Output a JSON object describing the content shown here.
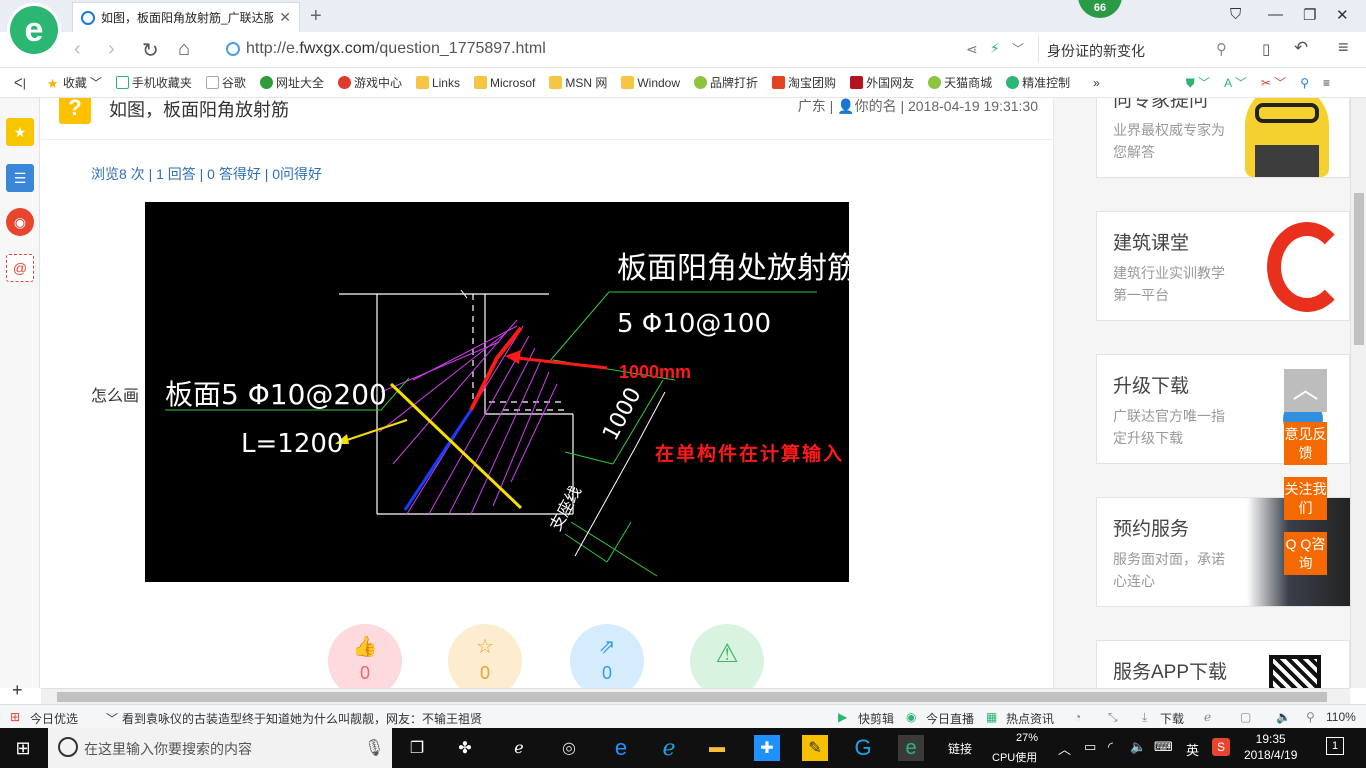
{
  "browser": {
    "tab_title": "如图，板面阳角放射筋_广联达服",
    "badge": "66",
    "url_prefix": "http://e.",
    "url_domain": "fwxgx.com",
    "url_path": "/question_1775897.html",
    "search_text": "身份证的新变化"
  },
  "bookmarks": [
    "收藏",
    "手机收藏夹",
    "谷歌",
    "网址大全",
    "游戏中心",
    "Links",
    "Microsof",
    "MSN 网",
    "Window",
    "品牌打折",
    "淘宝团购",
    "外国网友",
    "天猫商城",
    "精准控制"
  ],
  "question": {
    "title": "如图，板面阳角放射筋",
    "meta": "广东 | ",
    "author": "你的名",
    "datetime": " | 2018-04-19 19:31:30",
    "stats": "浏览8 次 | 1 回答 | 0 答得好 | 0问得好",
    "body_prefix": "怎么画"
  },
  "cad": {
    "label_title": "板面阳角处放射筋",
    "label_spec": "5 Φ10@100",
    "label_left_spec": "板面5 Φ10@200",
    "label_length": "L=1200",
    "label_dim": "1000",
    "label_red": "1000mm",
    "label_input": "在单构件在计算输入",
    "label_support": "支座线"
  },
  "actions": [
    {
      "name": "like",
      "count": "0",
      "color": "#f7b6bd"
    },
    {
      "name": "collect",
      "count": "0",
      "color": "#fde3b4"
    },
    {
      "name": "share",
      "count": "0",
      "color": "#bfe3fb"
    },
    {
      "name": "report",
      "count": "",
      "color": "#c9efd6"
    }
  ],
  "sidebar": [
    {
      "title": "向专家提问",
      "sub": "业界最权威专家为您解答"
    },
    {
      "title": "建筑课堂",
      "sub": "建筑行业实训教学第一平台"
    },
    {
      "title": "升级下载",
      "sub": "广联达官方唯一指定升级下载"
    },
    {
      "title": "预约服务",
      "sub": "服务面对面，承诺心连心"
    },
    {
      "title": "服务APP下载",
      "sub": ""
    }
  ],
  "float_buttons": [
    "意见反馈",
    "关注我们",
    "Q Q咨询"
  ],
  "statusbar": {
    "left": "今日优选",
    "news": "看到袁咏仪的古装造型终于知道她为什么叫靓靓，网友：不输王祖贤",
    "items": [
      "快剪辑",
      "今日直播",
      "热点资讯",
      "下载"
    ],
    "zoom": "110%"
  },
  "taskbar": {
    "search_placeholder": "在这里输入你要搜索的内容",
    "link": "链接",
    "cpu": "27%",
    "cpu_label": "CPU使用",
    "ime": "英",
    "time": "19:35",
    "date": "2018/4/19",
    "notif": "1"
  }
}
